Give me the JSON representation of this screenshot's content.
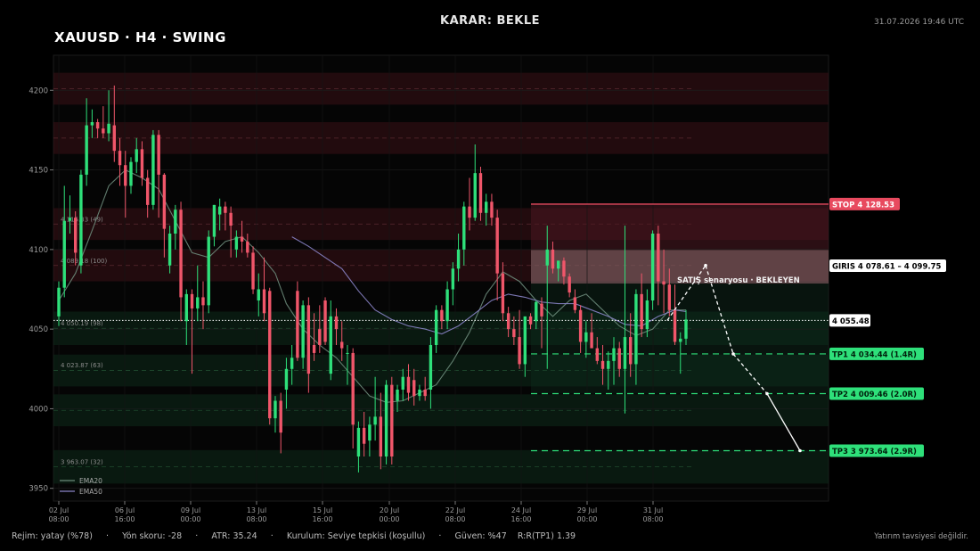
{
  "header": {
    "decision": "KARAR: BEKLE",
    "timestamp": "31.07.2026 19:46 UTC",
    "title": "XAUUSD   ·   H4   ·   SWING"
  },
  "footer": {
    "text": "Rejim: yatay (%78)     ·     Yön skoru: -28     ·     ATR: 35.24     ·     Kurulum: Seviye tepkisi (koşullu)     ·     Güven: %47    R:R(TP1) 1.39",
    "disclaimer": "Yatırım tavsiyesi değildir."
  },
  "colors": {
    "up": "#2ee07a",
    "down": "#f0566a",
    "stop": "#e84a5f",
    "entry": "#ffffff",
    "tp": "#2ee07a",
    "ema20": "#6c8a7a",
    "ema50": "#8a84c8"
  },
  "chart_data": {
    "type": "candlestick",
    "symbol": "XAUUSD",
    "timeframe": "H4",
    "ylim": [
      3942,
      4222
    ],
    "y_ticks": [
      3950,
      4000,
      4050,
      4100,
      4150,
      4200
    ],
    "x_tick_labels": [
      [
        "02 Jul",
        "08:00"
      ],
      [
        "06 Jul",
        "16:00"
      ],
      [
        "09 Jul",
        "00:00"
      ],
      [
        "13 Jul",
        "08:00"
      ],
      [
        "15 Jul",
        "16:00"
      ],
      [
        "20 Jul",
        "00:00"
      ],
      [
        "22 Jul",
        "08:00"
      ],
      [
        "24 Jul",
        "16:00"
      ],
      [
        "29 Jul",
        "00:00"
      ],
      [
        "31 Jul",
        "08:00"
      ]
    ],
    "legend": [
      "EMA20",
      "EMA50"
    ],
    "legend_position": "bottom-left",
    "grid": true,
    "levels": {
      "stop": {
        "label": "STOP  4 128.53",
        "value": 4128.53
      },
      "entry": {
        "label": "GIRIS  4 078.61 – 4 099.75",
        "low": 4078.61,
        "high": 4099.75
      },
      "current": {
        "label": "4 055.48",
        "value": 4055.48
      },
      "tp1": {
        "label": "TP1  4 034.44  (1.4R)",
        "value": 4034.44
      },
      "tp2": {
        "label": "TP2  4 009.46  (2.0R)",
        "value": 4009.46
      },
      "tp3": {
        "label": "TP3  3 973.64  (2.9R)",
        "value": 3973.64
      }
    },
    "scenario_label": "SATIŞ senaryosu  ·  BEKLEYEN",
    "scenario_path": [
      4055.48,
      4090,
      4034.44,
      4009.46,
      3973.64
    ],
    "zone_labels": [
      {
        "text": "4 115.33  (49)",
        "value": 4115.33
      },
      {
        "text": "4 089.18  (100)",
        "value": 4089.18
      },
      {
        "text": "4 050.19  (98)",
        "value": 4050.19
      },
      {
        "text": "4 023.87  (63)",
        "value": 4023.87
      },
      {
        "text": "3 963.07  (32)",
        "value": 3963.07
      }
    ],
    "resistance_zones": [
      [
        4191,
        4211
      ],
      [
        4160,
        4180
      ],
      [
        4106,
        4126
      ],
      [
        4080,
        4100
      ]
    ],
    "support_zones": [
      [
        4040,
        4061
      ],
      [
        4014,
        4034
      ],
      [
        3989,
        4009
      ],
      [
        3953,
        3974
      ]
    ],
    "candles": [
      {
        "o": 4058,
        "h": 4080,
        "l": 4052,
        "c": 4076
      },
      {
        "o": 4076,
        "h": 4140,
        "l": 4070,
        "c": 4118
      },
      {
        "o": 4118,
        "h": 4134,
        "l": 4110,
        "c": 4120
      },
      {
        "o": 4120,
        "h": 4124,
        "l": 4090,
        "c": 4098
      },
      {
        "o": 4090,
        "h": 4150,
        "l": 4085,
        "c": 4147
      },
      {
        "o": 4147,
        "h": 4195,
        "l": 4140,
        "c": 4178
      },
      {
        "o": 4178,
        "h": 4188,
        "l": 4170,
        "c": 4180
      },
      {
        "o": 4180,
        "h": 4182,
        "l": 4170,
        "c": 4176
      },
      {
        "o": 4176,
        "h": 4190,
        "l": 4170,
        "c": 4173
      },
      {
        "o": 4173,
        "h": 4200,
        "l": 4168,
        "c": 4179
      },
      {
        "o": 4178,
        "h": 4203,
        "l": 4155,
        "c": 4162
      },
      {
        "o": 4162,
        "h": 4170,
        "l": 4140,
        "c": 4153
      },
      {
        "o": 4153,
        "h": 4162,
        "l": 4120,
        "c": 4140
      },
      {
        "o": 4140,
        "h": 4158,
        "l": 4135,
        "c": 4155
      },
      {
        "o": 4155,
        "h": 4170,
        "l": 4148,
        "c": 4163
      },
      {
        "o": 4163,
        "h": 4168,
        "l": 4140,
        "c": 4145
      },
      {
        "o": 4145,
        "h": 4150,
        "l": 4120,
        "c": 4128
      },
      {
        "o": 4128,
        "h": 4175,
        "l": 4125,
        "c": 4172
      },
      {
        "o": 4172,
        "h": 4175,
        "l": 4120,
        "c": 4147
      },
      {
        "o": 4147,
        "h": 4148,
        "l": 4095,
        "c": 4113
      },
      {
        "o": 4090,
        "h": 4115,
        "l": 4085,
        "c": 4110
      },
      {
        "o": 4110,
        "h": 4128,
        "l": 4100,
        "c": 4125
      },
      {
        "o": 4125,
        "h": 4130,
        "l": 4055,
        "c": 4070
      },
      {
        "o": 4055,
        "h": 4075,
        "l": 4040,
        "c": 4072
      },
      {
        "o": 4072,
        "h": 4075,
        "l": 4022,
        "c": 4063
      },
      {
        "o": 4063,
        "h": 4090,
        "l": 4055,
        "c": 4070
      },
      {
        "o": 4070,
        "h": 4080,
        "l": 4050,
        "c": 4065
      },
      {
        "o": 4065,
        "h": 4112,
        "l": 4060,
        "c": 4108
      },
      {
        "o": 4108,
        "h": 4128,
        "l": 4102,
        "c": 4128
      },
      {
        "o": 4122,
        "h": 4132,
        "l": 4112,
        "c": 4127
      },
      {
        "o": 4127,
        "h": 4130,
        "l": 4112,
        "c": 4123
      },
      {
        "o": 4123,
        "h": 4127,
        "l": 4095,
        "c": 4115
      },
      {
        "o": 4100,
        "h": 4112,
        "l": 4095,
        "c": 4108
      },
      {
        "o": 4108,
        "h": 4118,
        "l": 4098,
        "c": 4105
      },
      {
        "o": 4105,
        "h": 4110,
        "l": 4095,
        "c": 4098
      },
      {
        "o": 4098,
        "h": 4102,
        "l": 4072,
        "c": 4075
      },
      {
        "o": 4068,
        "h": 4085,
        "l": 4058,
        "c": 4075
      },
      {
        "o": 4075,
        "h": 4095,
        "l": 4055,
        "c": 4060
      },
      {
        "o": 4074,
        "h": 4076,
        "l": 3990,
        "c": 3994
      },
      {
        "o": 3994,
        "h": 4008,
        "l": 3985,
        "c": 4005
      },
      {
        "o": 4005,
        "h": 4010,
        "l": 3972,
        "c": 3985
      },
      {
        "o": 4012,
        "h": 4032,
        "l": 4000,
        "c": 4025
      },
      {
        "o": 4025,
        "h": 4040,
        "l": 4015,
        "c": 4032
      },
      {
        "o": 4074,
        "h": 4080,
        "l": 4030,
        "c": 4032
      },
      {
        "o": 4032,
        "h": 4068,
        "l": 4025,
        "c": 4065
      },
      {
        "o": 4065,
        "h": 4070,
        "l": 4010,
        "c": 4022
      },
      {
        "o": 4040,
        "h": 4060,
        "l": 4030,
        "c": 4035
      },
      {
        "o": 4050,
        "h": 4065,
        "l": 4035,
        "c": 4040
      },
      {
        "o": 4068,
        "h": 4070,
        "l": 4040,
        "c": 4042
      },
      {
        "o": 4022,
        "h": 4068,
        "l": 4018,
        "c": 4058
      },
      {
        "o": 4058,
        "h": 4063,
        "l": 4040,
        "c": 4050
      },
      {
        "o": 4042,
        "h": 4055,
        "l": 4030,
        "c": 4038
      },
      {
        "o": 4035,
        "h": 4040,
        "l": 4015,
        "c": 4035
      },
      {
        "o": 4035,
        "h": 4038,
        "l": 3975,
        "c": 3990
      },
      {
        "o": 3970,
        "h": 3992,
        "l": 3960,
        "c": 3988
      },
      {
        "o": 3988,
        "h": 3998,
        "l": 3970,
        "c": 3978
      },
      {
        "o": 3980,
        "h": 3995,
        "l": 3970,
        "c": 3990
      },
      {
        "o": 3990,
        "h": 4020,
        "l": 3980,
        "c": 3995
      },
      {
        "o": 3995,
        "h": 4010,
        "l": 3962,
        "c": 3970
      },
      {
        "o": 3970,
        "h": 4018,
        "l": 3965,
        "c": 4015
      },
      {
        "o": 4015,
        "h": 4020,
        "l": 3965,
        "c": 3970
      },
      {
        "o": 4005,
        "h": 4015,
        "l": 3998,
        "c": 4012
      },
      {
        "o": 4012,
        "h": 4025,
        "l": 4005,
        "c": 4020
      },
      {
        "o": 4020,
        "h": 4028,
        "l": 4005,
        "c": 4010
      },
      {
        "o": 4018,
        "h": 4025,
        "l": 4002,
        "c": 4008
      },
      {
        "o": 4008,
        "h": 4015,
        "l": 4005,
        "c": 4012
      },
      {
        "o": 4012,
        "h": 4020,
        "l": 4005,
        "c": 4008
      },
      {
        "o": 4012,
        "h": 4045,
        "l": 4000,
        "c": 4040
      },
      {
        "o": 4040,
        "h": 4065,
        "l": 4035,
        "c": 4062
      },
      {
        "o": 4062,
        "h": 4065,
        "l": 4050,
        "c": 4055
      },
      {
        "o": 4055,
        "h": 4080,
        "l": 4050,
        "c": 4075
      },
      {
        "o": 4075,
        "h": 4092,
        "l": 4065,
        "c": 4088
      },
      {
        "o": 4088,
        "h": 4110,
        "l": 4080,
        "c": 4100
      },
      {
        "o": 4100,
        "h": 4130,
        "l": 4090,
        "c": 4127
      },
      {
        "o": 4127,
        "h": 4145,
        "l": 4112,
        "c": 4120
      },
      {
        "o": 4120,
        "h": 4166,
        "l": 4118,
        "c": 4148
      },
      {
        "o": 4148,
        "h": 4152,
        "l": 4118,
        "c": 4123
      },
      {
        "o": 4123,
        "h": 4135,
        "l": 4115,
        "c": 4130
      },
      {
        "o": 4130,
        "h": 4135,
        "l": 4115,
        "c": 4120
      },
      {
        "o": 4120,
        "h": 4125,
        "l": 4068,
        "c": 4085
      },
      {
        "o": 4085,
        "h": 4092,
        "l": 4055,
        "c": 4060
      },
      {
        "o": 4060,
        "h": 4064,
        "l": 4045,
        "c": 4050
      },
      {
        "o": 4050,
        "h": 4058,
        "l": 4040,
        "c": 4045
      },
      {
        "o": 4045,
        "h": 4062,
        "l": 4025,
        "c": 4028
      },
      {
        "o": 4028,
        "h": 4045,
        "l": 4020,
        "c": 4058
      },
      {
        "o": 4058,
        "h": 4060,
        "l": 4050,
        "c": 4053
      },
      {
        "o": 4055,
        "h": 4068,
        "l": 4050,
        "c": 4067
      },
      {
        "o": 4066,
        "h": 4070,
        "l": 4038,
        "c": 4058
      },
      {
        "o": 4090,
        "h": 4115,
        "l": 4025,
        "c": 4100
      },
      {
        "o": 4100,
        "h": 4105,
        "l": 4085,
        "c": 4088
      },
      {
        "o": 4088,
        "h": 4093,
        "l": 4080,
        "c": 4093
      },
      {
        "o": 4093,
        "h": 4095,
        "l": 4078,
        "c": 4083
      },
      {
        "o": 4083,
        "h": 4085,
        "l": 4070,
        "c": 4073
      },
      {
        "o": 4070,
        "h": 4075,
        "l": 4060,
        "c": 4062
      },
      {
        "o": 4062,
        "h": 4065,
        "l": 4035,
        "c": 4042
      },
      {
        "o": 4042,
        "h": 4055,
        "l": 4032,
        "c": 4048
      },
      {
        "o": 4048,
        "h": 4060,
        "l": 4045,
        "c": 4038
      },
      {
        "o": 4038,
        "h": 4045,
        "l": 4028,
        "c": 4030
      },
      {
        "o": 4030,
        "h": 4040,
        "l": 4015,
        "c": 4025
      },
      {
        "o": 4025,
        "h": 4036,
        "l": 4012,
        "c": 4030
      },
      {
        "o": 4030,
        "h": 4045,
        "l": 4015,
        "c": 4038
      },
      {
        "o": 4038,
        "h": 4042,
        "l": 4020,
        "c": 4025
      },
      {
        "o": 4025,
        "h": 4115,
        "l": 3997,
        "c": 4045
      },
      {
        "o": 4045,
        "h": 4060,
        "l": 4020,
        "c": 4028
      },
      {
        "o": 4028,
        "h": 4075,
        "l": 4015,
        "c": 4072
      },
      {
        "o": 4072,
        "h": 4085,
        "l": 4045,
        "c": 4050
      },
      {
        "o": 4050,
        "h": 4075,
        "l": 4045,
        "c": 4068
      },
      {
        "o": 4068,
        "h": 4112,
        "l": 4062,
        "c": 4110
      },
      {
        "o": 4110,
        "h": 4115,
        "l": 4065,
        "c": 4080
      },
      {
        "o": 4080,
        "h": 4100,
        "l": 4060,
        "c": 4078
      },
      {
        "o": 4078,
        "h": 4088,
        "l": 4058,
        "c": 4062
      },
      {
        "o": 4062,
        "h": 4078,
        "l": 4040,
        "c": 4042
      },
      {
        "o": 4042,
        "h": 4048,
        "l": 4022,
        "c": 4044
      },
      {
        "o": 4044,
        "h": 4062,
        "l": 4040,
        "c": 4056
      }
    ],
    "ema20": [
      [
        0,
        4068
      ],
      [
        3,
        4085
      ],
      [
        6,
        4112
      ],
      [
        9,
        4140
      ],
      [
        12,
        4150
      ],
      [
        15,
        4145
      ],
      [
        18,
        4138
      ],
      [
        21,
        4118
      ],
      [
        24,
        4098
      ],
      [
        27,
        4095
      ],
      [
        30,
        4105
      ],
      [
        33,
        4108
      ],
      [
        36,
        4098
      ],
      [
        39,
        4085
      ],
      [
        41,
        4066
      ],
      [
        44,
        4050
      ],
      [
        47,
        4040
      ],
      [
        50,
        4032
      ],
      [
        53,
        4020
      ],
      [
        56,
        4008
      ],
      [
        59,
        4004
      ],
      [
        62,
        4005
      ],
      [
        65,
        4010
      ],
      [
        68,
        4015
      ],
      [
        71,
        4030
      ],
      [
        74,
        4048
      ],
      [
        77,
        4072
      ],
      [
        80,
        4086
      ],
      [
        83,
        4080
      ],
      [
        86,
        4068
      ],
      [
        89,
        4058
      ],
      [
        92,
        4068
      ],
      [
        95,
        4072
      ],
      [
        98,
        4062
      ],
      [
        101,
        4052
      ],
      [
        104,
        4046
      ],
      [
        107,
        4050
      ],
      [
        110,
        4062
      ],
      [
        113,
        4062
      ]
    ],
    "ema50": [
      [
        42,
        4108
      ],
      [
        45,
        4102
      ],
      [
        48,
        4095
      ],
      [
        51,
        4088
      ],
      [
        54,
        4074
      ],
      [
        57,
        4062
      ],
      [
        60,
        4056
      ],
      [
        63,
        4052
      ],
      [
        66,
        4050
      ],
      [
        69,
        4047
      ],
      [
        72,
        4052
      ],
      [
        75,
        4060
      ],
      [
        78,
        4068
      ],
      [
        81,
        4072
      ],
      [
        84,
        4070
      ],
      [
        87,
        4067
      ],
      [
        90,
        4066
      ],
      [
        93,
        4066
      ],
      [
        96,
        4062
      ],
      [
        99,
        4058
      ],
      [
        102,
        4053
      ],
      [
        105,
        4052
      ],
      [
        108,
        4058
      ],
      [
        111,
        4062
      ],
      [
        113,
        4061
      ]
    ]
  }
}
